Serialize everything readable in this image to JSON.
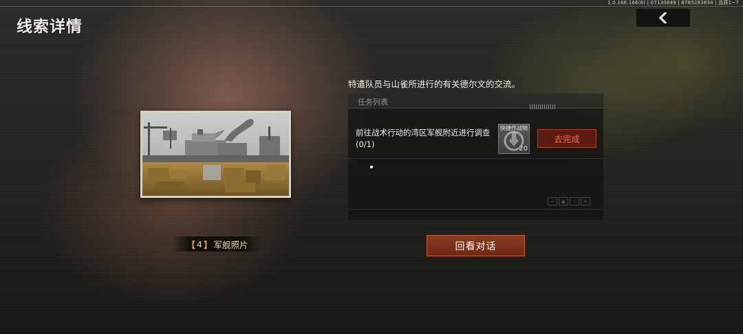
{
  "header": {
    "title": "线索详情",
    "build_info": "1.0.166.166(6) | 07130849 | 8785283834 | 品质1~7",
    "back_icon": "chevron-left-icon"
  },
  "clue": {
    "label_open": "【",
    "label_number": "4",
    "label_close": "】",
    "label_name": "军舰照片"
  },
  "detail": {
    "description": "特遣队员与山雀所进行的有关德尔文的交流。"
  },
  "tasks": {
    "header": "任务列表",
    "items": [
      {
        "text": "前往战术行动的湾区军舰附近进行调查(0/1)",
        "reward_name": "快捷作战物资",
        "reward_count": "20",
        "action_label": "去完成"
      }
    ]
  },
  "actions": {
    "review_label": "回看对话"
  },
  "colors": {
    "accent": "#c85a35",
    "go_text": "#ff6a4a",
    "label_gold": "#f0d79a"
  }
}
